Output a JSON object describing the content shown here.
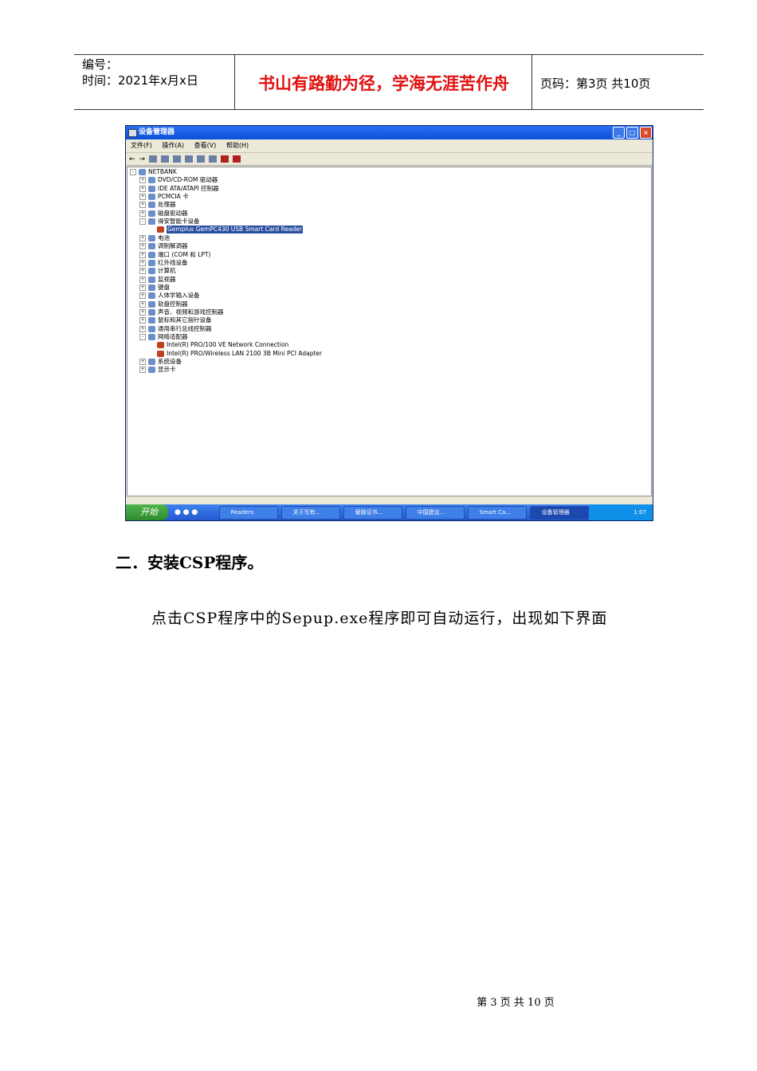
{
  "header": {
    "number_label": "编号：",
    "time_label": "时间：2021年x月x日",
    "motto": "书山有路勤为径，学海无涯苦作舟",
    "page_label": "页码：第3页  共10页"
  },
  "screenshot": {
    "title": "设备管理器",
    "window_buttons": [
      "_",
      "□",
      "×"
    ],
    "menu": [
      "文件(F)",
      "操作(A)",
      "查看(V)",
      "帮助(H)"
    ],
    "tree": [
      {
        "label": "NETBANK",
        "level": 0,
        "exp": "-"
      },
      {
        "label": "DVD/CD-ROM 驱动器",
        "level": 1,
        "exp": "+"
      },
      {
        "label": "IDE ATA/ATAPI 控制器",
        "level": 1,
        "exp": "+"
      },
      {
        "label": "PCMCIA 卡",
        "level": 1,
        "exp": "+"
      },
      {
        "label": "处理器",
        "level": 1,
        "exp": "+"
      },
      {
        "label": "磁盘驱动器",
        "level": 1,
        "exp": "+"
      },
      {
        "label": "得安智能卡设备",
        "level": 1,
        "exp": "-"
      },
      {
        "label": "Gemplus GemPC430 USB Smart Card Reader",
        "level": 2,
        "exp": "",
        "selected": true
      },
      {
        "label": "电池",
        "level": 1,
        "exp": "+"
      },
      {
        "label": "调制解调器",
        "level": 1,
        "exp": "+"
      },
      {
        "label": "端口 (COM 和 LPT)",
        "level": 1,
        "exp": "+"
      },
      {
        "label": "红外线设备",
        "level": 1,
        "exp": "+"
      },
      {
        "label": "计算机",
        "level": 1,
        "exp": "+"
      },
      {
        "label": "监视器",
        "level": 1,
        "exp": "+"
      },
      {
        "label": "键盘",
        "level": 1,
        "exp": "+"
      },
      {
        "label": "人体学输入设备",
        "level": 1,
        "exp": "+"
      },
      {
        "label": "软盘控制器",
        "level": 1,
        "exp": "+"
      },
      {
        "label": "声音、视频和游戏控制器",
        "level": 1,
        "exp": "+"
      },
      {
        "label": "鼠标和其它指针设备",
        "level": 1,
        "exp": "+"
      },
      {
        "label": "通用串行总线控制器",
        "level": 1,
        "exp": "+"
      },
      {
        "label": "网络适配器",
        "level": 1,
        "exp": "-"
      },
      {
        "label": "Intel(R) PRO/100 VE Network Connection",
        "level": 2,
        "exp": ""
      },
      {
        "label": "Intel(R) PRO/Wireless LAN 2100 3B Mini PCI Adapter",
        "level": 2,
        "exp": ""
      },
      {
        "label": "系统设备",
        "level": 1,
        "exp": "+"
      },
      {
        "label": "显示卡",
        "level": 1,
        "exp": "+"
      }
    ],
    "taskbar": {
      "start": "开始",
      "buttons": [
        "Readers",
        "关于写有...",
        "替换证书...",
        "中国建设...",
        "Smart Ca...",
        "设备管理器"
      ],
      "active": 5,
      "clock": "1:07"
    }
  },
  "body": {
    "heading": "二．安装CSP程序。",
    "paragraph": "点击CSP程序中的Sepup.exe程序即可自动运行，出现如下界面"
  },
  "footer": "第 3 页 共 10 页"
}
